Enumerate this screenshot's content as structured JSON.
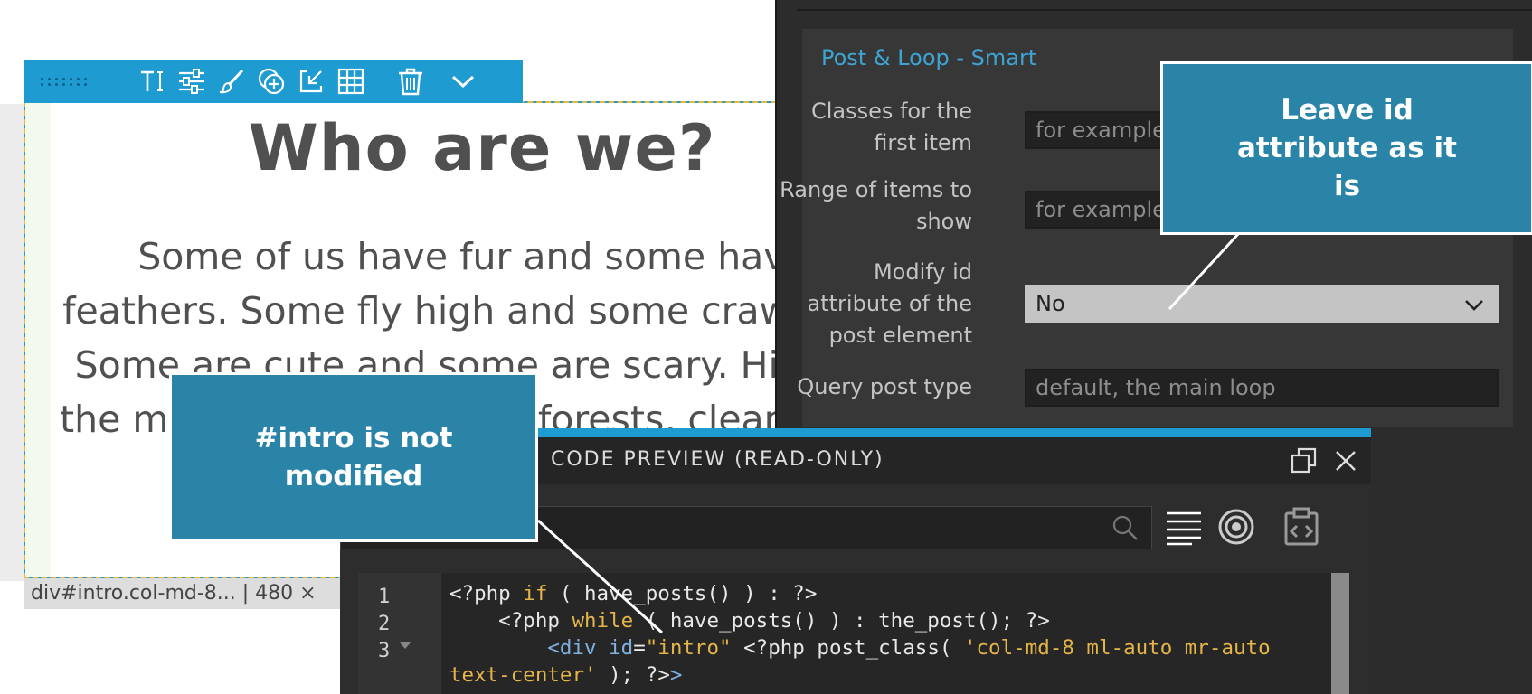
{
  "canvas": {
    "heading": "Who are we?",
    "paragraph": "Some of us have fur and some have feathers. Some fly high and some crawl low. Some are cute and some are scary. High in the mountains, in distant forests, clear lakes and"
  },
  "element_toolbar": {
    "icons": [
      "drag-handle",
      "text-icon",
      "settings-sliders-icon",
      "brush-icon",
      "insert-icon",
      "import-icon",
      "grid-icon",
      "trash-icon",
      "chevron-down-icon"
    ]
  },
  "status_bar": {
    "text": "div#intro.col-md-8... | 480 ×"
  },
  "properties": {
    "section_title": "Post & Loop - Smart",
    "fields": [
      {
        "label": "Classes for the first item",
        "placeholder": "for example"
      },
      {
        "label": "Range of items to show",
        "placeholder": "for example"
      },
      {
        "label": "Modify id attribute of the post element",
        "value": "No"
      },
      {
        "label": "Query post type",
        "placeholder": "default, the main loop"
      }
    ]
  },
  "code_preview": {
    "title": "CODE PREVIEW (READ-ONLY)",
    "line_numbers": [
      "1",
      "2",
      "3"
    ]
  },
  "callouts": {
    "id_note": "Leave id attribute as it is",
    "intro_note": "#intro is not modified"
  },
  "colors": {
    "accent": "#1e9bd0",
    "callout_bg": "#2a84a8",
    "panel_bg": "#2c2c2c",
    "section_title": "#3ea4d4",
    "code_keyword": "#e6b54a"
  }
}
